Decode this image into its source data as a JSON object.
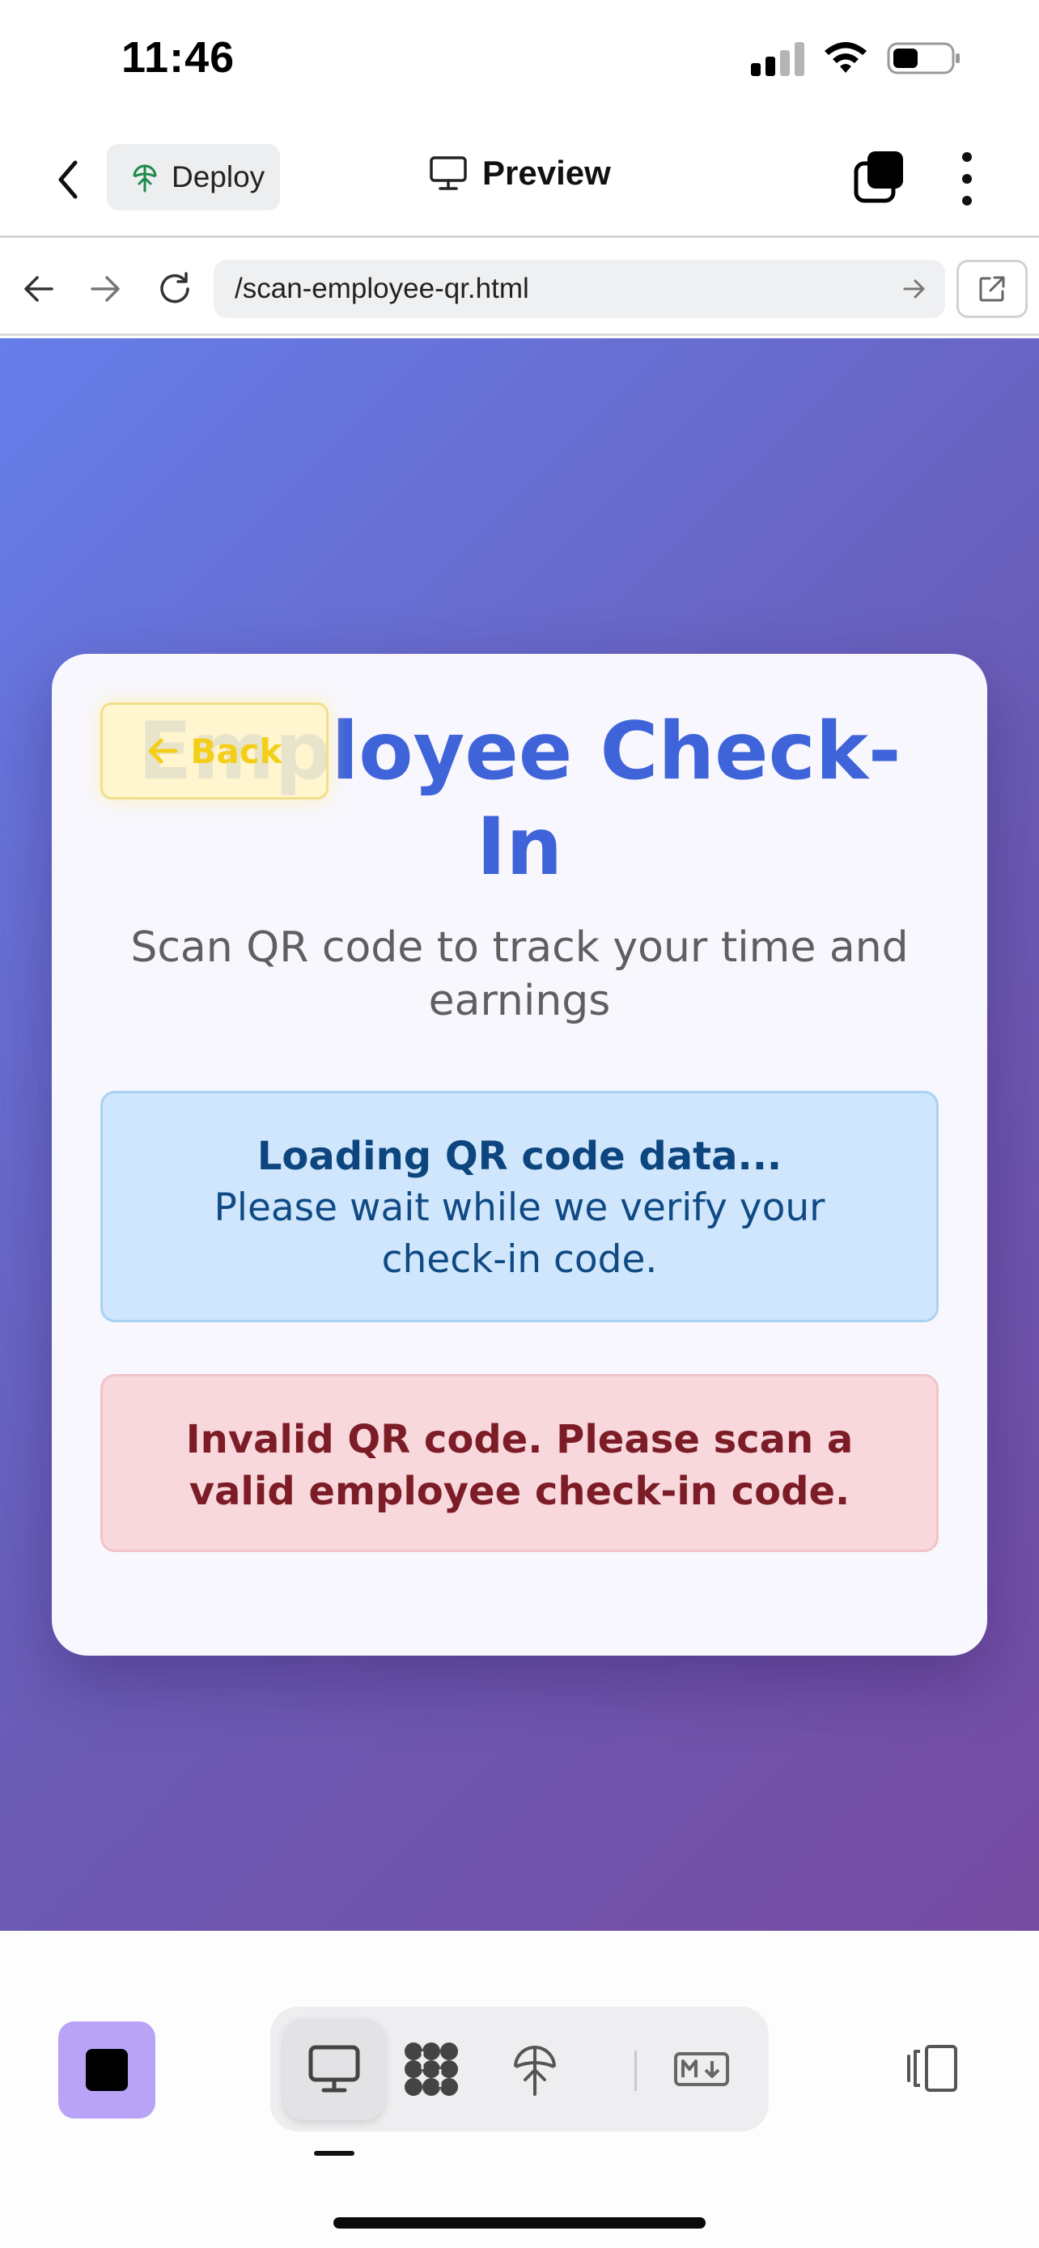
{
  "status_bar": {
    "time": "11:46"
  },
  "header": {
    "deploy_label": "Deploy",
    "preview_label": "Preview",
    "icons": [
      "back-chevron-icon",
      "deploy-icon",
      "monitor-icon",
      "tabs-icon",
      "more-vertical-icon"
    ]
  },
  "browser": {
    "url": "/scan-employee-qr.html",
    "icons": [
      "arrow-left-icon",
      "arrow-right-icon",
      "reload-icon",
      "go-arrow-icon",
      "external-link-icon"
    ]
  },
  "page": {
    "title": "Employee Check-In",
    "back_label": "Back",
    "subtitle": "Scan QR code to track your time and earnings",
    "info_heading": "Loading QR code data...",
    "info_body": "Please wait while we verify your check-in code.",
    "error_message": "Invalid QR code. Please scan a valid employee check-in code.",
    "colors": {
      "gradient_start": "#667eea",
      "gradient_end": "#764ba2",
      "title": "#3f64d9",
      "back_text": "#f4cf1a",
      "info_bg": "#cfe6fc",
      "info_text": "#0d467f",
      "error_bg": "#f8d8dc",
      "error_text": "#7c1c26"
    }
  },
  "toolbar": {
    "stop_color": "#b8a3f7",
    "modes": [
      "desktop-preview-icon",
      "components-icon",
      "deploy-icon",
      "markdown-icon"
    ],
    "active_mode": "desktop-preview-icon",
    "layout_toggle_icon": "split-view-icon"
  }
}
